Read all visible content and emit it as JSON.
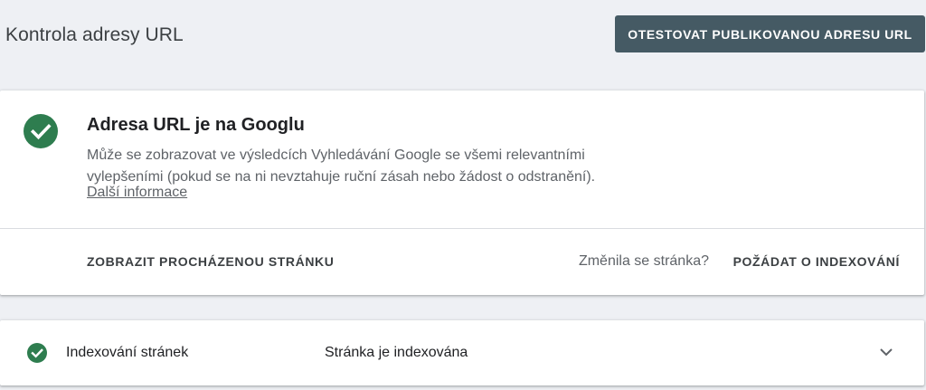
{
  "header": {
    "title": "Kontrola adresy URL",
    "test_live_label": "OTESTOVAT PUBLIKOVANOU ADRESU URL"
  },
  "status_card": {
    "title": "Adresa URL je na Googlu",
    "description": "Může se zobrazovat ve výsledcích Vyhledávání Google se všemi relevantními vylepšeními (pokud se na ni nevztahuje ruční zásah nebo žádost o odstranění).",
    "more_info": "Další informace",
    "view_crawled_label": "ZOBRAZIT PROCHÁZENOU STRÁNKU",
    "page_changed_text": "Změnila se stránka?",
    "request_index_label": "POŽÁDAT O INDEXOVÁNÍ"
  },
  "index_row": {
    "label": "Indexování stránek",
    "status": "Stránka je indexována"
  },
  "colors": {
    "success_green": "#1e8e3e",
    "button_bg": "#455a64",
    "background": "#eef0f4"
  },
  "icons": {
    "status": "check-circle-icon",
    "row": "check-circle-icon",
    "expand": "chevron-down-icon"
  }
}
